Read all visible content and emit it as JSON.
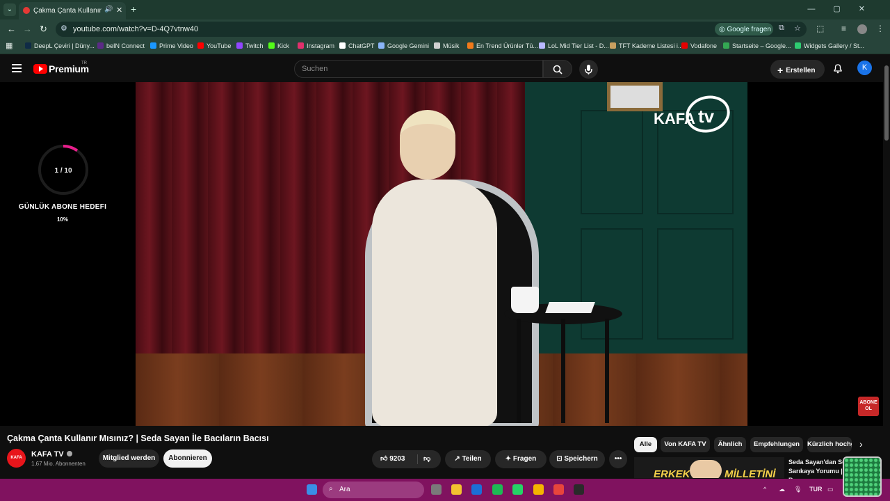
{
  "browser": {
    "tab": {
      "title": "Çakma Çanta Kullanır Mısını"
    },
    "url": "youtube.com/watch?v=D-4Q7vtnw40",
    "google_fragen": "Google fragen",
    "bookmarks": [
      {
        "label": "DeepL Çeviri | Düny...",
        "color": "#0f2b46"
      },
      {
        "label": "beIN Connect",
        "color": "#5b2a86"
      },
      {
        "label": "Prime Video",
        "color": "#1a98ff"
      },
      {
        "label": "YouTube",
        "color": "#ff0000"
      },
      {
        "label": "Twitch",
        "color": "#9146ff"
      },
      {
        "label": "Kick",
        "color": "#53fc18"
      },
      {
        "label": "Instagram",
        "color": "#e1306c"
      },
      {
        "label": "ChatGPT",
        "color": "#ffffff"
      },
      {
        "label": "Google Gemini",
        "color": "#8ab4f8"
      },
      {
        "label": "Müsik",
        "color": "#d0d0d0"
      },
      {
        "label": "En Trend Ürünler Tü...",
        "color": "#f27a1a"
      },
      {
        "label": "LoL Mid Tier List - D...",
        "color": "#b8b8ff"
      },
      {
        "label": "TFT Kademe Listesi i...",
        "color": "#c8a060"
      },
      {
        "label": "Vodafone",
        "color": "#e60000"
      },
      {
        "label": "Startseite – Google...",
        "color": "#34a853"
      },
      {
        "label": "Widgets Gallery / St...",
        "color": "#2ecc71"
      }
    ]
  },
  "youtube": {
    "logo_text": "Premium",
    "logo_sup": "TR",
    "search_placeholder": "Suchen",
    "create_label": "Erstellen",
    "avatar_letter": "K"
  },
  "overlay": {
    "goal_count": "1 / 10",
    "goal_label": "GÜNLÜK ABONE HEDEFI",
    "goal_percent": "10%",
    "goal_progress": 0.1,
    "abone_badge": "ABONE OL",
    "kafa_logo": "KAFA tv"
  },
  "video": {
    "title": "Çakma Çanta Kullanır Mısınız? | Seda Sayan İle Bacıların Bacısı",
    "channel": "KAFA TV",
    "channel_avatar": "KAFA",
    "subscribers": "1,67 Mio. Abonnenten",
    "member_label": "Mitglied werden",
    "subscribe_label": "Abonnieren",
    "likes": "9203",
    "share_label": "Teilen",
    "ask_label": "Fragen",
    "save_label": "Speichern"
  },
  "chips": [
    "Alle",
    "Von KAFA TV",
    "Ähnlich",
    "Empfehlungen",
    "Kürzlich hochgeladen"
  ],
  "recommendation": {
    "title": "Seda Sayan'dan Serenay Sarıkaya Yorumu | Dragon Bae...",
    "thumb_left": "ERKEK",
    "thumb_right": "MİLLETİNİ"
  },
  "taskbar": {
    "search_placeholder": "Ara",
    "lang": "TUR",
    "icons": [
      {
        "name": "start",
        "color": "#3a8ee6"
      },
      {
        "name": "calculator",
        "color": "#7a7a7a"
      },
      {
        "name": "file-explorer",
        "color": "#f2c230"
      },
      {
        "name": "mail",
        "color": "#1c6fd6"
      },
      {
        "name": "spotify",
        "color": "#1db954"
      },
      {
        "name": "whatsapp",
        "color": "#25d366"
      },
      {
        "name": "discord",
        "color": "#f5b400"
      },
      {
        "name": "chrome",
        "color": "#e8453c"
      },
      {
        "name": "obs",
        "color": "#2a2a2a"
      }
    ]
  }
}
